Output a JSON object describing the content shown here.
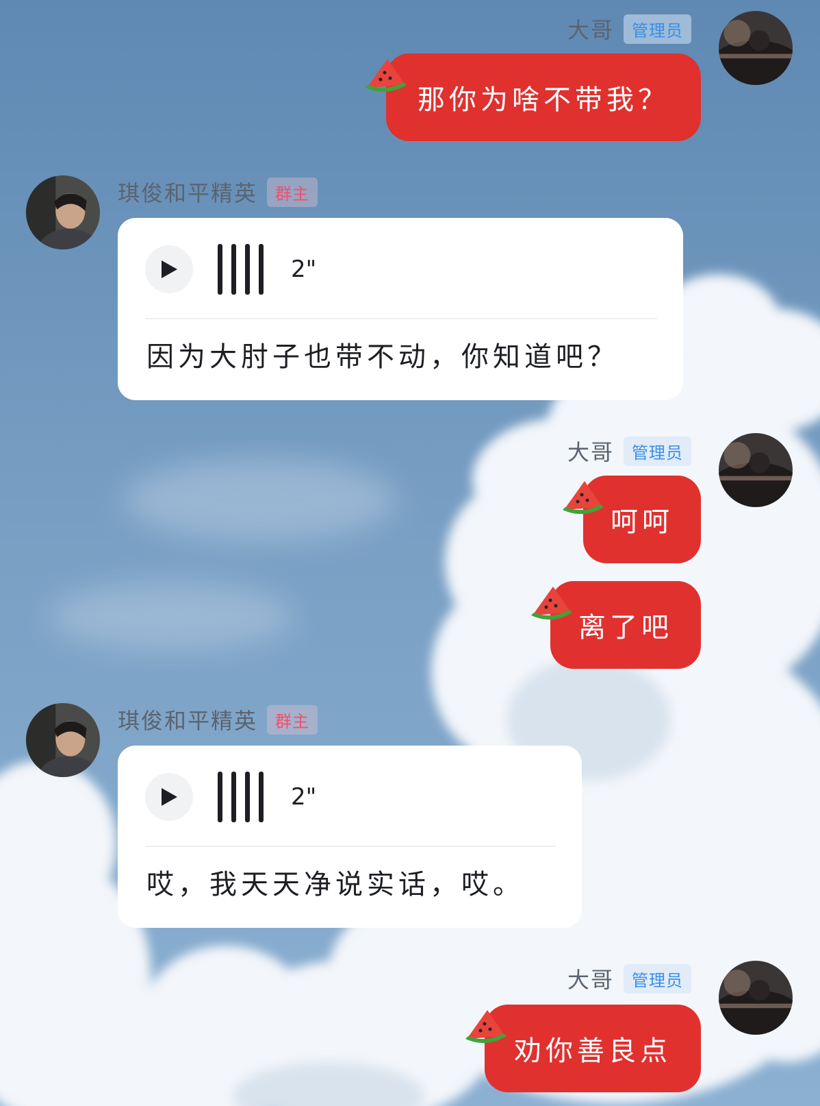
{
  "chat": {
    "messages": [
      {
        "side": "right",
        "sender": "大哥",
        "role": "管理员",
        "text": "那你为啥不带我？"
      },
      {
        "side": "left",
        "sender": "琪俊和平精英",
        "role": "群主",
        "voice_duration": "2\"",
        "transcript": "因为大肘子也带不动，你知道吧？"
      },
      {
        "side": "right",
        "sender": "大哥",
        "role": "管理员",
        "text": "呵呵"
      },
      {
        "side": "right",
        "text": "离了吧"
      },
      {
        "side": "left",
        "sender": "琪俊和平精英",
        "role": "群主",
        "voice_duration": "2\"",
        "transcript": "哎，我天天净说实话，哎。"
      },
      {
        "side": "right",
        "sender": "大哥",
        "role": "管理员",
        "text": "劝你善良点"
      }
    ]
  },
  "colors": {
    "bubble_red": "#e0312f",
    "admin_badge": "#3a8ee6",
    "owner_badge": "#f0506e",
    "card_bg": "#ffffff"
  },
  "icons": {
    "sticker": "watermelon-icon",
    "voice_play": "play-icon",
    "voice_wave": "voice-wave-icon"
  }
}
